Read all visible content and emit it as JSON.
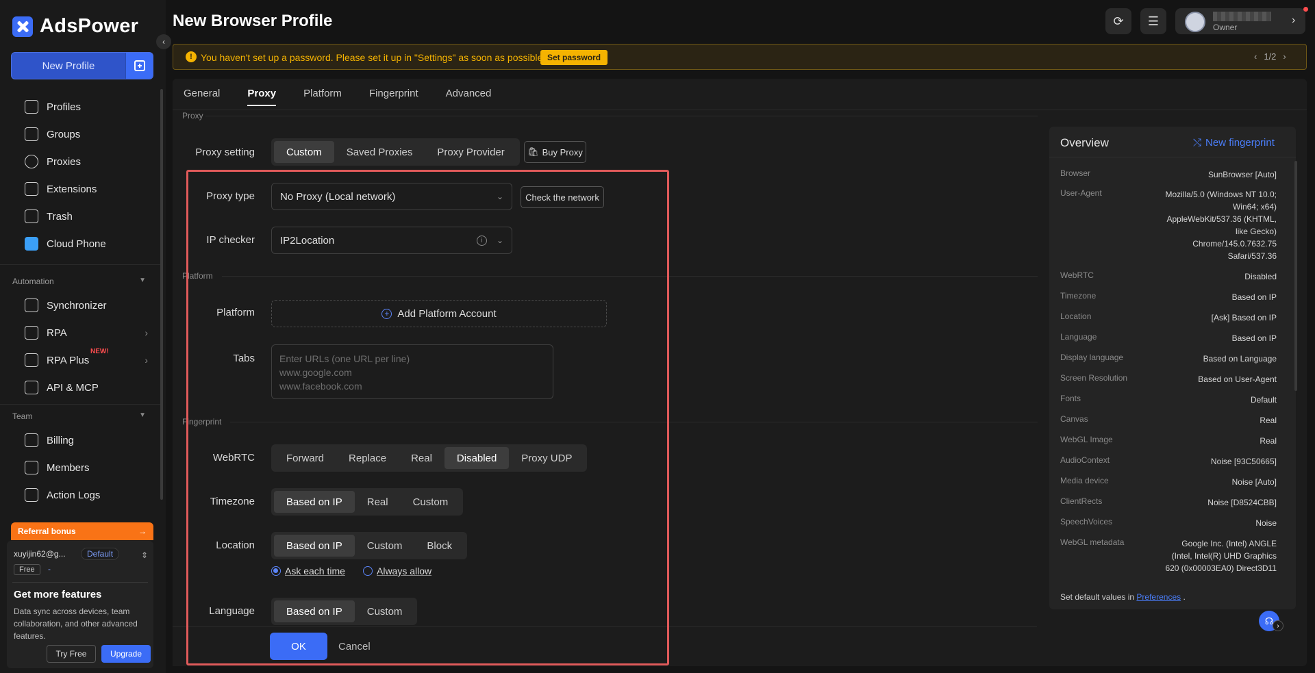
{
  "app": {
    "name": "AdsPower",
    "accent": "#3b6cf6"
  },
  "sidebar": {
    "new_profile_label": "New Profile",
    "main_items": [
      {
        "label": "Profiles",
        "icon": "profiles-icon"
      },
      {
        "label": "Groups",
        "icon": "folder-icon"
      },
      {
        "label": "Proxies",
        "icon": "globe-icon"
      },
      {
        "label": "Extensions",
        "icon": "puzzle-icon"
      },
      {
        "label": "Trash",
        "icon": "trash-icon"
      },
      {
        "label": "Cloud Phone",
        "icon": "cloud-phone-icon"
      }
    ],
    "automation_label": "Automation",
    "automation_items": [
      {
        "label": "Synchronizer",
        "icon": "synchronizer-icon"
      },
      {
        "label": "RPA",
        "icon": "rpa-icon"
      },
      {
        "label": "RPA Plus",
        "icon": "rpa-plus-icon",
        "badge": "NEW!"
      },
      {
        "label": "API & MCP",
        "icon": "api-icon"
      }
    ],
    "team_label": "Team",
    "team_items": [
      {
        "label": "Billing",
        "icon": "billing-icon"
      },
      {
        "label": "Members",
        "icon": "members-icon"
      },
      {
        "label": "Action Logs",
        "icon": "action-logs-icon"
      }
    ],
    "referral_label": "Referral bonus",
    "referral_arrow": "→",
    "account": {
      "email": "xuyijin62@g...",
      "group": "Default",
      "plan": "Free",
      "plan_extra": "-"
    },
    "promo": {
      "title": "Get more features",
      "description": "Data sync across devices, team collaboration, and other advanced features.",
      "try_free": "Try Free",
      "upgrade": "Upgrade"
    }
  },
  "header": {
    "title": "New Browser Profile",
    "user_role": "Owner"
  },
  "warning": {
    "icon": "!",
    "text": "You haven't set up a password. Please set it up in \"Settings\" as soon as possible.",
    "button": "Set password",
    "pager": "1/2"
  },
  "tabs": [
    "General",
    "Proxy",
    "Platform",
    "Fingerprint",
    "Advanced"
  ],
  "active_tab": "Proxy",
  "proxy": {
    "section_label": "Proxy",
    "setting_label": "Proxy setting",
    "setting_options": [
      "Custom",
      "Saved Proxies",
      "Proxy Provider"
    ],
    "buy_proxy": "Buy Proxy",
    "type_label": "Proxy type",
    "type_value": "No Proxy (Local network)",
    "check_network": "Check the network",
    "ip_checker_label": "IP checker",
    "ip_checker_value": "IP2Location"
  },
  "platform": {
    "section_label": "Platform",
    "platform_label": "Platform",
    "add_account": "Add Platform Account",
    "tabs_label": "Tabs",
    "tabs_placeholder": "Enter URLs (one URL per line)\nwww.google.com\nwww.facebook.com"
  },
  "fingerprint": {
    "section_label": "Fingerprint",
    "webrtc_label": "WebRTC",
    "webrtc_options": [
      "Forward",
      "Replace",
      "Real",
      "Disabled",
      "Proxy UDP"
    ],
    "timezone_label": "Timezone",
    "timezone_options": [
      "Based on IP",
      "Real",
      "Custom"
    ],
    "location_label": "Location",
    "location_options": [
      "Based on IP",
      "Custom",
      "Block"
    ],
    "location_radios": [
      "Ask each time",
      "Always allow"
    ],
    "language_label": "Language",
    "language_options": [
      "Based on IP",
      "Custom"
    ]
  },
  "footer": {
    "ok": "OK",
    "cancel": "Cancel"
  },
  "overview": {
    "title": "Overview",
    "new_fingerprint": "New fingerprint",
    "rows": [
      {
        "key": "Browser",
        "value": "SunBrowser [Auto]"
      },
      {
        "key": "User-Agent",
        "value": "Mozilla/5.0 (Windows NT 10.0; Win64; x64) AppleWebKit/537.36 (KHTML, like Gecko) Chrome/145.0.7632.75 Safari/537.36"
      },
      {
        "key": "WebRTC",
        "value": "Disabled"
      },
      {
        "key": "Timezone",
        "value": "Based on IP"
      },
      {
        "key": "Location",
        "value": "[Ask] Based on IP"
      },
      {
        "key": "Language",
        "value": "Based on IP"
      },
      {
        "key": "Display language",
        "value": "Based on Language"
      },
      {
        "key": "Screen Resolution",
        "value": "Based on User-Agent"
      },
      {
        "key": "Fonts",
        "value": "Default"
      },
      {
        "key": "Canvas",
        "value": "Real"
      },
      {
        "key": "WebGL Image",
        "value": "Real"
      },
      {
        "key": "AudioContext",
        "value": "Noise [93C50665]"
      },
      {
        "key": "Media device",
        "value": "Noise [Auto]"
      },
      {
        "key": "ClientRects",
        "value": "Noise [D8524CBB]"
      },
      {
        "key": "SpeechVoices",
        "value": "Noise"
      },
      {
        "key": "WebGL metadata",
        "value": "Google Inc. (Intel) ANGLE (Intel, Intel(R) UHD Graphics 620 (0x00003EA0) Direct3D11"
      }
    ],
    "footer_prefix": "Set default values in",
    "footer_link": "Preferences",
    "footer_suffix": "."
  }
}
